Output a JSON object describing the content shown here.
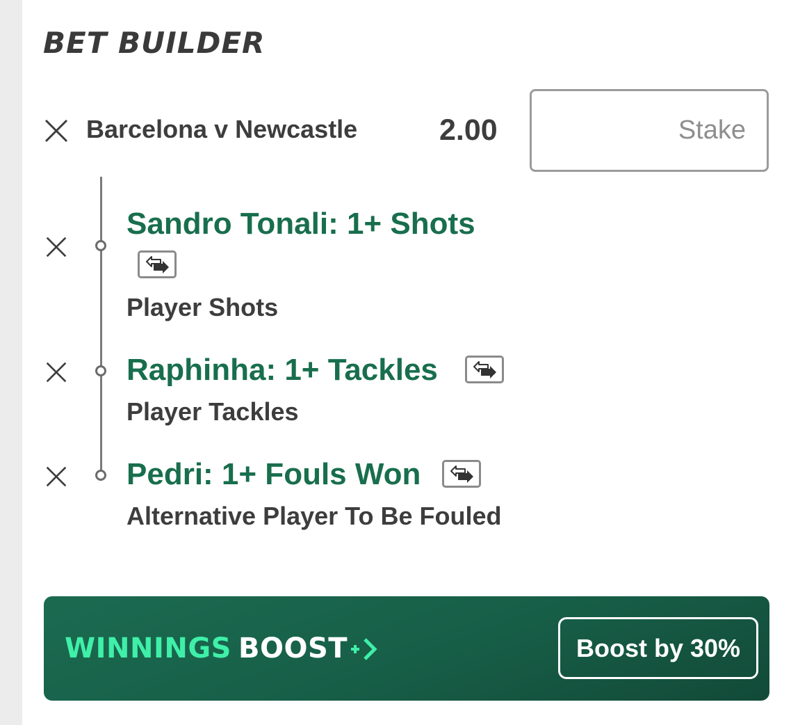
{
  "header": {
    "title": "BET BUILDER"
  },
  "event": {
    "name": "Barcelona v Newcastle",
    "odds": "2.00",
    "stake_placeholder": "Stake"
  },
  "selections": [
    {
      "title": "Sandro Tonali: 1+ Shots",
      "market": "Player Shots",
      "icon": "swap-icon"
    },
    {
      "title": "Raphinha: 1+ Tackles",
      "market": "Player Tackles",
      "icon": "swap-icon"
    },
    {
      "title": "Pedri: 1+ Fouls Won",
      "market": "Alternative Player To Be Fouled",
      "icon": "swap-icon"
    }
  ],
  "boost": {
    "label_primary": "WINNINGS",
    "label_secondary": "BOOST",
    "button_label": "Boost by 30%",
    "colors": {
      "accent": "#3ff0a8",
      "background": "#175e47"
    }
  },
  "colors": {
    "selection_title": "#186e4d",
    "text": "#3d3d3d"
  }
}
